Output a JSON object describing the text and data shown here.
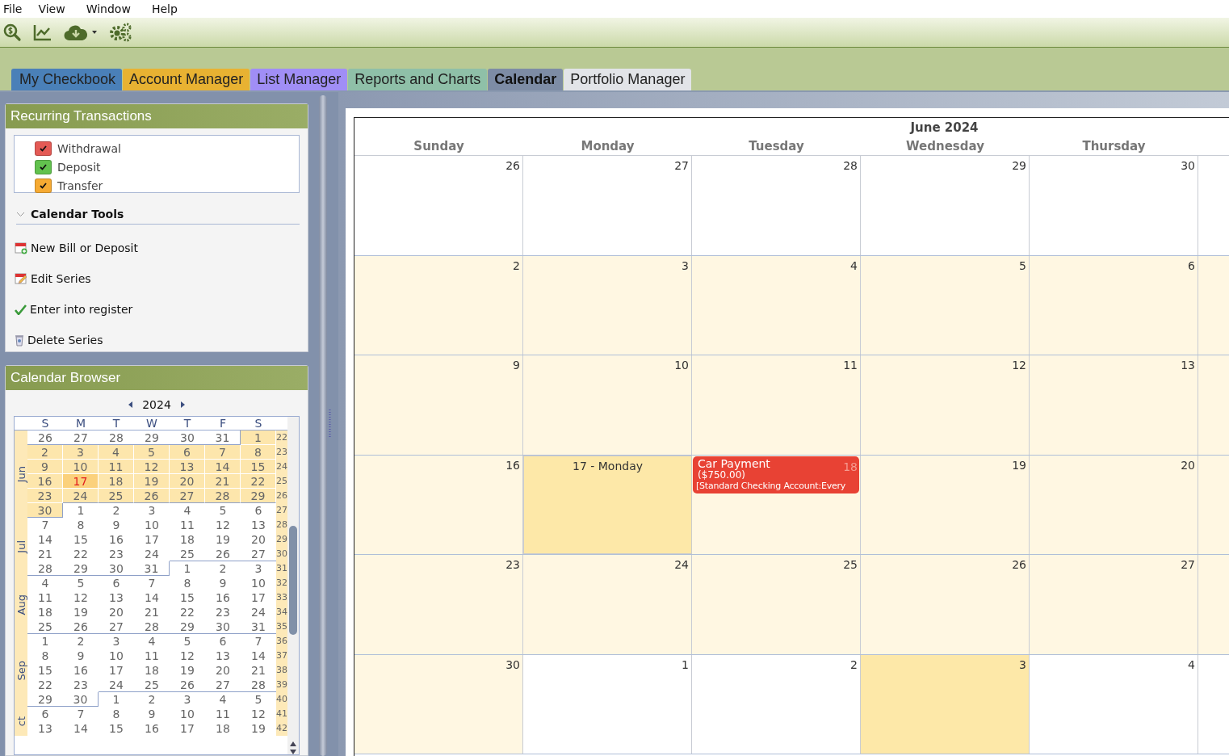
{
  "menu": [
    "File",
    "View",
    "Window",
    "Help"
  ],
  "tabs": [
    {
      "label": "My Checkbook",
      "selected": false,
      "color": "#4a80b8"
    },
    {
      "label": "Account Manager",
      "selected": false,
      "color": "#e8b232"
    },
    {
      "label": "List Manager",
      "selected": false,
      "color": "#a08ef6"
    },
    {
      "label": "Reports and Charts",
      "selected": false,
      "color": "#8fc0a8"
    },
    {
      "label": "Calendar",
      "selected": true,
      "color": "#7d8ca5"
    },
    {
      "label": "Portfolio Manager",
      "selected": false,
      "color": "#e2e4e8"
    }
  ],
  "recurring": {
    "title": "Recurring Transactions",
    "legend": [
      {
        "label": "Withdrawal",
        "checked": true,
        "color": "#e45a55"
      },
      {
        "label": "Deposit",
        "checked": true,
        "color": "#62c24e"
      },
      {
        "label": "Transfer",
        "checked": true,
        "color": "#f6aa32"
      }
    ],
    "tools_title": "Calendar Tools",
    "tools_expanded": true,
    "tools": [
      {
        "label": "New Bill or Deposit",
        "kind": "new"
      },
      {
        "label": "Edit Series",
        "kind": "edit"
      },
      {
        "label": "Enter into register",
        "kind": "enter"
      },
      {
        "label": "Delete Series",
        "kind": "delete"
      }
    ]
  },
  "browser": {
    "title": "Calendar Browser",
    "year": "2024",
    "weekdays": [
      "S",
      "M",
      "T",
      "W",
      "T",
      "F",
      "S"
    ],
    "months": [
      {
        "label": "Jun",
        "weeks": [
          {
            "num": "22",
            "days": [
              {
                "d": "26",
                "shaded": false,
                "selected": false
              },
              {
                "d": "27",
                "shaded": false,
                "selected": false
              },
              {
                "d": "28",
                "shaded": false,
                "selected": false
              },
              {
                "d": "29",
                "shaded": false,
                "selected": false
              },
              {
                "d": "30",
                "shaded": false,
                "selected": false
              },
              {
                "d": "31",
                "shaded": false,
                "selected": false
              },
              {
                "d": "1",
                "shaded": true,
                "selected": false
              }
            ]
          },
          {
            "num": "23",
            "days": [
              {
                "d": "2",
                "shaded": true,
                "selected": false
              },
              {
                "d": "3",
                "shaded": true,
                "selected": false
              },
              {
                "d": "4",
                "shaded": true,
                "selected": false
              },
              {
                "d": "5",
                "shaded": true,
                "selected": false
              },
              {
                "d": "6",
                "shaded": true,
                "selected": false
              },
              {
                "d": "7",
                "shaded": true,
                "selected": false
              },
              {
                "d": "8",
                "shaded": true,
                "selected": false
              }
            ]
          },
          {
            "num": "24",
            "days": [
              {
                "d": "9",
                "shaded": true,
                "selected": false
              },
              {
                "d": "10",
                "shaded": true,
                "selected": false
              },
              {
                "d": "11",
                "shaded": true,
                "selected": false
              },
              {
                "d": "12",
                "shaded": true,
                "selected": false
              },
              {
                "d": "13",
                "shaded": true,
                "selected": false
              },
              {
                "d": "14",
                "shaded": true,
                "selected": false
              },
              {
                "d": "15",
                "shaded": true,
                "selected": false
              }
            ]
          },
          {
            "num": "25",
            "days": [
              {
                "d": "16",
                "shaded": true,
                "selected": false
              },
              {
                "d": "17",
                "shaded": true,
                "selected": true
              },
              {
                "d": "18",
                "shaded": true,
                "selected": false
              },
              {
                "d": "19",
                "shaded": true,
                "selected": false
              },
              {
                "d": "20",
                "shaded": true,
                "selected": false
              },
              {
                "d": "21",
                "shaded": true,
                "selected": false
              },
              {
                "d": "22",
                "shaded": true,
                "selected": false
              }
            ]
          },
          {
            "num": "26",
            "days": [
              {
                "d": "23",
                "shaded": true,
                "selected": false
              },
              {
                "d": "24",
                "shaded": true,
                "selected": false
              },
              {
                "d": "25",
                "shaded": true,
                "selected": false
              },
              {
                "d": "26",
                "shaded": true,
                "selected": false
              },
              {
                "d": "27",
                "shaded": true,
                "selected": false
              },
              {
                "d": "28",
                "shaded": true,
                "selected": false
              },
              {
                "d": "29",
                "shaded": true,
                "selected": false
              }
            ]
          },
          {
            "num": "27",
            "days": [
              {
                "d": "30",
                "shaded": true,
                "selected": false
              },
              {
                "d": "1",
                "shaded": false,
                "selected": false
              },
              {
                "d": "2",
                "shaded": false,
                "selected": false
              },
              {
                "d": "3",
                "shaded": false,
                "selected": false
              },
              {
                "d": "4",
                "shaded": false,
                "selected": false
              },
              {
                "d": "5",
                "shaded": false,
                "selected": false
              },
              {
                "d": "6",
                "shaded": false,
                "selected": false
              }
            ]
          }
        ]
      },
      {
        "label": "Jul",
        "weeks": [
          {
            "num": "28",
            "days": [
              {
                "d": "7",
                "shaded": false,
                "selected": false
              },
              {
                "d": "8",
                "shaded": false,
                "selected": false
              },
              {
                "d": "9",
                "shaded": false,
                "selected": false
              },
              {
                "d": "10",
                "shaded": false,
                "selected": false
              },
              {
                "d": "11",
                "shaded": false,
                "selected": false
              },
              {
                "d": "12",
                "shaded": false,
                "selected": false
              },
              {
                "d": "13",
                "shaded": false,
                "selected": false
              }
            ]
          },
          {
            "num": "29",
            "days": [
              {
                "d": "14",
                "shaded": false,
                "selected": false
              },
              {
                "d": "15",
                "shaded": false,
                "selected": false
              },
              {
                "d": "16",
                "shaded": false,
                "selected": false
              },
              {
                "d": "17",
                "shaded": false,
                "selected": false
              },
              {
                "d": "18",
                "shaded": false,
                "selected": false
              },
              {
                "d": "19",
                "shaded": false,
                "selected": false
              },
              {
                "d": "20",
                "shaded": false,
                "selected": false
              }
            ]
          },
          {
            "num": "30",
            "days": [
              {
                "d": "21",
                "shaded": false,
                "selected": false
              },
              {
                "d": "22",
                "shaded": false,
                "selected": false
              },
              {
                "d": "23",
                "shaded": false,
                "selected": false
              },
              {
                "d": "24",
                "shaded": false,
                "selected": false
              },
              {
                "d": "25",
                "shaded": false,
                "selected": false
              },
              {
                "d": "26",
                "shaded": false,
                "selected": false
              },
              {
                "d": "27",
                "shaded": false,
                "selected": false
              }
            ]
          },
          {
            "num": "31",
            "days": [
              {
                "d": "28",
                "shaded": false,
                "selected": false
              },
              {
                "d": "29",
                "shaded": false,
                "selected": false
              },
              {
                "d": "30",
                "shaded": false,
                "selected": false
              },
              {
                "d": "31",
                "shaded": false,
                "selected": false
              },
              {
                "d": "1",
                "shaded": false,
                "selected": false
              },
              {
                "d": "2",
                "shaded": false,
                "selected": false
              },
              {
                "d": "3",
                "shaded": false,
                "selected": false
              }
            ]
          }
        ]
      },
      {
        "label": "Aug",
        "weeks": [
          {
            "num": "32",
            "days": [
              {
                "d": "4",
                "shaded": false,
                "selected": false
              },
              {
                "d": "5",
                "shaded": false,
                "selected": false
              },
              {
                "d": "6",
                "shaded": false,
                "selected": false
              },
              {
                "d": "7",
                "shaded": false,
                "selected": false
              },
              {
                "d": "8",
                "shaded": false,
                "selected": false
              },
              {
                "d": "9",
                "shaded": false,
                "selected": false
              },
              {
                "d": "10",
                "shaded": false,
                "selected": false
              }
            ]
          },
          {
            "num": "33",
            "days": [
              {
                "d": "11",
                "shaded": false,
                "selected": false
              },
              {
                "d": "12",
                "shaded": false,
                "selected": false
              },
              {
                "d": "13",
                "shaded": false,
                "selected": false
              },
              {
                "d": "14",
                "shaded": false,
                "selected": false
              },
              {
                "d": "15",
                "shaded": false,
                "selected": false
              },
              {
                "d": "16",
                "shaded": false,
                "selected": false
              },
              {
                "d": "17",
                "shaded": false,
                "selected": false
              }
            ]
          },
          {
            "num": "34",
            "days": [
              {
                "d": "18",
                "shaded": false,
                "selected": false
              },
              {
                "d": "19",
                "shaded": false,
                "selected": false
              },
              {
                "d": "20",
                "shaded": false,
                "selected": false
              },
              {
                "d": "21",
                "shaded": false,
                "selected": false
              },
              {
                "d": "22",
                "shaded": false,
                "selected": false
              },
              {
                "d": "23",
                "shaded": false,
                "selected": false
              },
              {
                "d": "24",
                "shaded": false,
                "selected": false
              }
            ]
          },
          {
            "num": "35",
            "days": [
              {
                "d": "25",
                "shaded": false,
                "selected": false
              },
              {
                "d": "26",
                "shaded": false,
                "selected": false
              },
              {
                "d": "27",
                "shaded": false,
                "selected": false
              },
              {
                "d": "28",
                "shaded": false,
                "selected": false
              },
              {
                "d": "29",
                "shaded": false,
                "selected": false
              },
              {
                "d": "30",
                "shaded": false,
                "selected": false
              },
              {
                "d": "31",
                "shaded": false,
                "selected": false
              }
            ]
          }
        ]
      },
      {
        "label": "Sep",
        "weeks": [
          {
            "num": "36",
            "days": [
              {
                "d": "1",
                "shaded": false,
                "selected": false
              },
              {
                "d": "2",
                "shaded": false,
                "selected": false
              },
              {
                "d": "3",
                "shaded": false,
                "selected": false
              },
              {
                "d": "4",
                "shaded": false,
                "selected": false
              },
              {
                "d": "5",
                "shaded": false,
                "selected": false
              },
              {
                "d": "6",
                "shaded": false,
                "selected": false
              },
              {
                "d": "7",
                "shaded": false,
                "selected": false
              }
            ]
          },
          {
            "num": "37",
            "days": [
              {
                "d": "8",
                "shaded": false,
                "selected": false
              },
              {
                "d": "9",
                "shaded": false,
                "selected": false
              },
              {
                "d": "10",
                "shaded": false,
                "selected": false
              },
              {
                "d": "11",
                "shaded": false,
                "selected": false
              },
              {
                "d": "12",
                "shaded": false,
                "selected": false
              },
              {
                "d": "13",
                "shaded": false,
                "selected": false
              },
              {
                "d": "14",
                "shaded": false,
                "selected": false
              }
            ]
          },
          {
            "num": "38",
            "days": [
              {
                "d": "15",
                "shaded": false,
                "selected": false
              },
              {
                "d": "16",
                "shaded": false,
                "selected": false
              },
              {
                "d": "17",
                "shaded": false,
                "selected": false
              },
              {
                "d": "18",
                "shaded": false,
                "selected": false
              },
              {
                "d": "19",
                "shaded": false,
                "selected": false
              },
              {
                "d": "20",
                "shaded": false,
                "selected": false
              },
              {
                "d": "21",
                "shaded": false,
                "selected": false
              }
            ]
          },
          {
            "num": "39",
            "days": [
              {
                "d": "22",
                "shaded": false,
                "selected": false
              },
              {
                "d": "23",
                "shaded": false,
                "selected": false
              },
              {
                "d": "24",
                "shaded": false,
                "selected": false
              },
              {
                "d": "25",
                "shaded": false,
                "selected": false
              },
              {
                "d": "26",
                "shaded": false,
                "selected": false
              },
              {
                "d": "27",
                "shaded": false,
                "selected": false
              },
              {
                "d": "28",
                "shaded": false,
                "selected": false
              }
            ]
          },
          {
            "num": "40",
            "days": [
              {
                "d": "29",
                "shaded": false,
                "selected": false
              },
              {
                "d": "30",
                "shaded": false,
                "selected": false
              },
              {
                "d": "1",
                "shaded": false,
                "selected": false
              },
              {
                "d": "2",
                "shaded": false,
                "selected": false
              },
              {
                "d": "3",
                "shaded": false,
                "selected": false
              },
              {
                "d": "4",
                "shaded": false,
                "selected": false
              },
              {
                "d": "5",
                "shaded": false,
                "selected": false
              }
            ]
          }
        ]
      },
      {
        "label": "ct",
        "weeks": [
          {
            "num": "41",
            "days": [
              {
                "d": "6",
                "shaded": false,
                "selected": false
              },
              {
                "d": "7",
                "shaded": false,
                "selected": false
              },
              {
                "d": "8",
                "shaded": false,
                "selected": false
              },
              {
                "d": "9",
                "shaded": false,
                "selected": false
              },
              {
                "d": "10",
                "shaded": false,
                "selected": false
              },
              {
                "d": "11",
                "shaded": false,
                "selected": false
              },
              {
                "d": "12",
                "shaded": false,
                "selected": false
              }
            ]
          },
          {
            "num": "42",
            "days": [
              {
                "d": "13",
                "shaded": false,
                "selected": false
              },
              {
                "d": "14",
                "shaded": false,
                "selected": false
              },
              {
                "d": "15",
                "shaded": false,
                "selected": false
              },
              {
                "d": "16",
                "shaded": false,
                "selected": false
              },
              {
                "d": "17",
                "shaded": false,
                "selected": false
              },
              {
                "d": "18",
                "shaded": false,
                "selected": false
              },
              {
                "d": "19",
                "shaded": false,
                "selected": false
              }
            ]
          }
        ]
      }
    ]
  },
  "calendar": {
    "title": "June 2024",
    "weekdays": [
      "Sunday",
      "Monday",
      "Tuesday",
      "Wednesday",
      "Thursday"
    ],
    "weeks": [
      [
        {
          "d": "26",
          "shaded": false,
          "selected": false,
          "highlighted": false
        },
        {
          "d": "27",
          "shaded": false,
          "selected": false,
          "highlighted": false
        },
        {
          "d": "28",
          "shaded": false,
          "selected": false,
          "highlighted": false
        },
        {
          "d": "29",
          "shaded": false,
          "selected": false,
          "highlighted": false
        },
        {
          "d": "30",
          "shaded": false,
          "selected": false,
          "highlighted": false
        }
      ],
      [
        {
          "d": "2",
          "shaded": true,
          "selected": false,
          "highlighted": false
        },
        {
          "d": "3",
          "shaded": true,
          "selected": false,
          "highlighted": false
        },
        {
          "d": "4",
          "shaded": true,
          "selected": false,
          "highlighted": false
        },
        {
          "d": "5",
          "shaded": true,
          "selected": false,
          "highlighted": false
        },
        {
          "d": "6",
          "shaded": true,
          "selected": false,
          "highlighted": false
        }
      ],
      [
        {
          "d": "9",
          "shaded": true,
          "selected": false,
          "highlighted": false
        },
        {
          "d": "10",
          "shaded": true,
          "selected": false,
          "highlighted": false
        },
        {
          "d": "11",
          "shaded": true,
          "selected": false,
          "highlighted": false
        },
        {
          "d": "12",
          "shaded": true,
          "selected": false,
          "highlighted": false
        },
        {
          "d": "13",
          "shaded": true,
          "selected": false,
          "highlighted": false
        }
      ],
      [
        {
          "d": "16",
          "shaded": true,
          "selected": false,
          "highlighted": false
        },
        {
          "d": "17 - Monday",
          "shaded": true,
          "selected": true,
          "highlighted": true
        },
        {
          "d": "18",
          "shaded": true,
          "selected": false,
          "highlighted": false,
          "events": [
            {
              "title": "Car Payment",
              "amount": "($750.00)",
              "detail": "[Standard Checking Account:Every",
              "color": "#e84234"
            }
          ]
        },
        {
          "d": "19",
          "shaded": true,
          "selected": false,
          "highlighted": false
        },
        {
          "d": "20",
          "shaded": true,
          "selected": false,
          "highlighted": false
        }
      ],
      [
        {
          "d": "23",
          "shaded": true,
          "selected": false,
          "highlighted": false
        },
        {
          "d": "24",
          "shaded": true,
          "selected": false,
          "highlighted": false
        },
        {
          "d": "25",
          "shaded": true,
          "selected": false,
          "highlighted": false
        },
        {
          "d": "26",
          "shaded": true,
          "selected": false,
          "highlighted": false
        },
        {
          "d": "27",
          "shaded": true,
          "selected": false,
          "highlighted": false
        }
      ],
      [
        {
          "d": "30",
          "shaded": true,
          "selected": false,
          "highlighted": false
        },
        {
          "d": "1",
          "shaded": false,
          "selected": false,
          "highlighted": false
        },
        {
          "d": "2",
          "shaded": false,
          "selected": false,
          "highlighted": false
        },
        {
          "d": "3",
          "shaded": false,
          "selected": false,
          "highlighted": true
        },
        {
          "d": "4",
          "shaded": false,
          "selected": false,
          "highlighted": false
        }
      ]
    ]
  }
}
